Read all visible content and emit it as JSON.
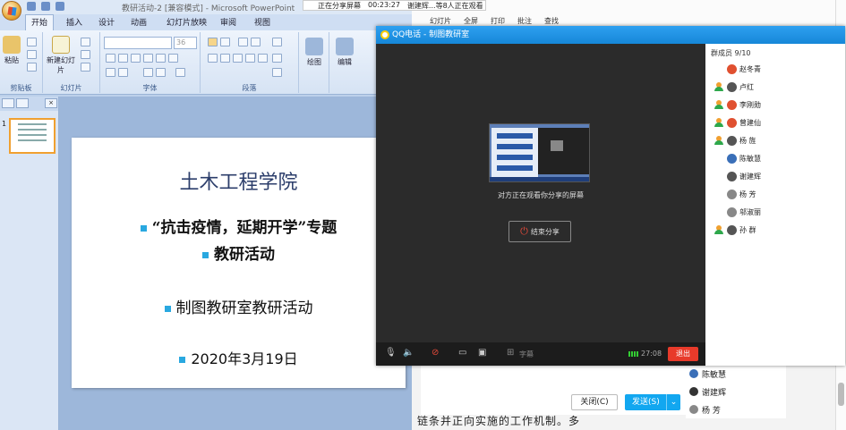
{
  "ppt": {
    "window_title": "教研活动-2 [兼容模式] - Microsoft PowerPoint",
    "tabs": [
      "开始",
      "插入",
      "设计",
      "动画",
      "幻灯片放映",
      "审阅",
      "视图"
    ],
    "groups": {
      "clipboard": "剪贴板",
      "slides": "幻灯片",
      "font": "字体",
      "paragraph": "段落",
      "drawing": "绘图",
      "editing": "编辑"
    },
    "paste_label": "粘贴",
    "new_slide_label": "新建幻灯片",
    "font_size": "36",
    "slide": {
      "title": "土木工程学院",
      "line1": "“抗击疫情，延期开学”专题",
      "line2": "教研活动",
      "line3": "制图教研室教研活动",
      "date": "2020年3月19日"
    },
    "thumb_number": "1"
  },
  "share_bar": {
    "status": "正在分享屏幕",
    "time": "00:23:27",
    "viewers": "谢建辉...等8人正在观看"
  },
  "bg_toolbar": [
    "幻灯片",
    "全屏",
    "打印",
    "批注",
    "查找"
  ],
  "qq": {
    "title": "QQ电话 - 制图教研室",
    "watching_text": "对方正在观看你分享的屏幕",
    "end_share": "结束分享",
    "subtitle_label": "字幕",
    "elapsed": "27:08",
    "exit_label": "退出",
    "members_header": "群成员 9/10",
    "members": [
      {
        "name": "赵冬青",
        "online": false
      },
      {
        "name": "卢红",
        "online": true
      },
      {
        "name": "李刚勋",
        "online": true
      },
      {
        "name": "曾建仙",
        "online": true
      },
      {
        "name": "杨 旌",
        "online": true
      },
      {
        "name": "陈敏慧",
        "online": false
      },
      {
        "name": "谢建辉",
        "online": false
      },
      {
        "name": "杨 芳",
        "online": false
      },
      {
        "name": "邬淑丽",
        "online": false
      },
      {
        "name": "孙 群",
        "online": true
      }
    ]
  },
  "chat": {
    "close_label": "关闭(C)",
    "send_label": "发送(S)",
    "list": [
      "陈敏慧",
      "谢建辉",
      "杨 芳"
    ]
  },
  "doc": {
    "text": "链条并正向实施的工作机制。多"
  }
}
